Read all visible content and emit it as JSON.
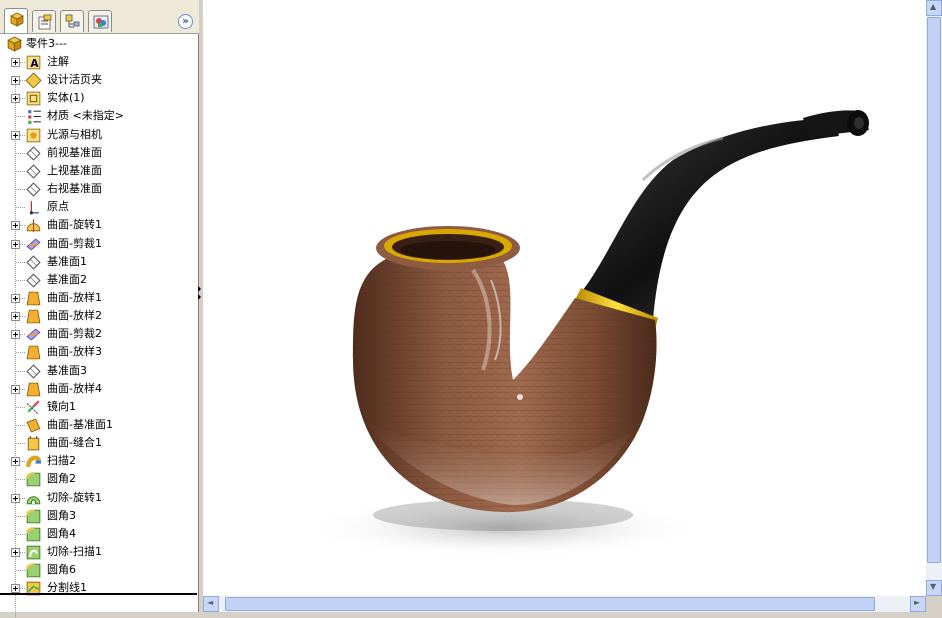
{
  "feature_manager": {
    "tabs": [
      {
        "icon": "feature-tree-icon",
        "active": true
      },
      {
        "icon": "property-manager-icon",
        "active": false
      },
      {
        "icon": "configuration-manager-icon",
        "active": false
      },
      {
        "icon": "display-manager-icon",
        "active": false
      }
    ],
    "expand_glyph": "»",
    "root": {
      "label": "零件3---",
      "icon": "part-icon"
    },
    "items": [
      {
        "label": "注解",
        "icon": "annotation-icon",
        "expandable": true
      },
      {
        "label": "设计活页夹",
        "icon": "design-binder-icon",
        "expandable": true
      },
      {
        "label": "实体(1)",
        "icon": "solid-body-icon",
        "expandable": true
      },
      {
        "label": "材质 <未指定>",
        "icon": "material-icon",
        "expandable": false
      },
      {
        "label": "光源与相机",
        "icon": "lights-camera-icon",
        "expandable": true
      },
      {
        "label": "前视基准面",
        "icon": "plane-icon",
        "expandable": false
      },
      {
        "label": "上视基准面",
        "icon": "plane-icon",
        "expandable": false
      },
      {
        "label": "右视基准面",
        "icon": "plane-icon",
        "expandable": false
      },
      {
        "label": "原点",
        "icon": "origin-icon",
        "expandable": false
      },
      {
        "label": "曲面-旋转1",
        "icon": "surface-revolve-icon",
        "expandable": true
      },
      {
        "label": "曲面-剪裁1",
        "icon": "surface-trim-icon",
        "expandable": true
      },
      {
        "label": "基准面1",
        "icon": "plane-icon",
        "expandable": false
      },
      {
        "label": "基准面2",
        "icon": "plane-icon",
        "expandable": false
      },
      {
        "label": "曲面-放样1",
        "icon": "surface-loft-icon",
        "expandable": true
      },
      {
        "label": "曲面-放样2",
        "icon": "surface-loft-icon",
        "expandable": true
      },
      {
        "label": "曲面-剪裁2",
        "icon": "surface-trim-icon",
        "expandable": true
      },
      {
        "label": "曲面-放样3",
        "icon": "surface-loft-icon",
        "expandable": false
      },
      {
        "label": "基准面3",
        "icon": "plane-icon",
        "expandable": false
      },
      {
        "label": "曲面-放样4",
        "icon": "surface-loft-icon",
        "expandable": true
      },
      {
        "label": "镜向1",
        "icon": "mirror-icon",
        "expandable": false
      },
      {
        "label": "曲面-基准面1",
        "icon": "planar-surface-icon",
        "expandable": false
      },
      {
        "label": "曲面-缝合1",
        "icon": "surface-knit-icon",
        "expandable": false
      },
      {
        "label": "扫描2",
        "icon": "sweep-icon",
        "expandable": true
      },
      {
        "label": "圆角2",
        "icon": "fillet-icon",
        "expandable": false
      },
      {
        "label": "切除-旋转1",
        "icon": "cut-revolve-icon",
        "expandable": true
      },
      {
        "label": "圆角3",
        "icon": "fillet-icon",
        "expandable": false
      },
      {
        "label": "圆角4",
        "icon": "fillet-icon",
        "expandable": false
      },
      {
        "label": "切除-扫描1",
        "icon": "cut-sweep-icon",
        "expandable": true
      },
      {
        "label": "圆角6",
        "icon": "fillet-icon",
        "expandable": false
      },
      {
        "label": "分割线1",
        "icon": "split-line-icon",
        "expandable": true
      }
    ]
  },
  "viewport": {
    "model": "tobacco-pipe-render",
    "colors": {
      "wood": "#7a4a33",
      "stem": "#1c1c1c",
      "band": "#f2c200",
      "background": "#ffffff"
    }
  },
  "scrollbars": {
    "vertical": {
      "up_glyph": "▲",
      "down_glyph": "▼"
    },
    "horizontal": {
      "left_glyph": "◄",
      "right_glyph": "►"
    }
  }
}
